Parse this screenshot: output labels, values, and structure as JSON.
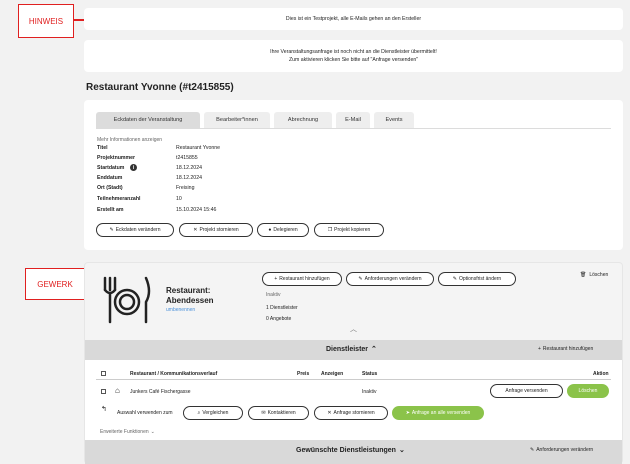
{
  "annotations": {
    "hinweis": "HINWEIS",
    "gewerk": "GEWERK",
    "color": "#e02020"
  },
  "notice1": "Dies ist ein Testprojekt, alle E-Mails gehen an den Ersteller",
  "notice2": {
    "line1": "Ihre Veranstaltungsanfrage ist noch nicht an die Dienstleister übermittelt!",
    "line2": "Zum aktivieren klicken Sie bitte auf \"Anfrage versenden\""
  },
  "page_title": "Restaurant Yvonne (#t2415855)",
  "tabs": [
    {
      "label": "Eckdaten der Veranstaltung"
    },
    {
      "label": "Bearbeiter*innen"
    },
    {
      "label": "Abrechnung"
    },
    {
      "label": "E-Mail"
    },
    {
      "label": "Events"
    }
  ],
  "more_info_link": "Mehr Informationen anzeigen",
  "details": [
    {
      "key": "Titel",
      "value": "Restaurant Yvonne"
    },
    {
      "key": "Projektnummer",
      "value": "t2415855"
    },
    {
      "key": "Startdatum",
      "value": "18.12.2024"
    },
    {
      "key": "Enddatum",
      "value": "18.12.2024"
    },
    {
      "key": "Ort (Stadt)",
      "value": "Freising"
    },
    {
      "key": "Teilnehmeranzahl",
      "value": "10"
    },
    {
      "key": "Erstellt am",
      "value": "15.10.2024 15:46"
    }
  ],
  "actions": {
    "edit": "Eckdaten verändern",
    "cancel": "Projekt stornieren",
    "delegate": "Delegieren",
    "copy": "Projekt kopieren"
  },
  "gewerk": {
    "name": "Restaurant: Abendessen",
    "sub": "umbenennen",
    "status": "Inaktiv",
    "providers_count": "1 Dienstleister",
    "offers_count": "0 Angebote",
    "btn_add": "Restaurant hinzufügen",
    "btn_requirements": "Anforderungen verändern",
    "btn_deadline": "Optionsfrist ändern",
    "delete": "Löschen"
  },
  "providers": {
    "header": "Dienstleister",
    "add": "Restaurant hinzufügen",
    "columns": [
      "Restaurant / Kommunikationsverlauf",
      "Preis",
      "Anzeigen",
      "Status",
      "Aktion"
    ],
    "rows": [
      {
        "name": "Junkers Café Fischergasse",
        "status": "Inaktiv",
        "send": "Anfrage versenden",
        "delete": "Löschen"
      }
    ],
    "selection_label": "Auswahl verwenden zum",
    "btn_compare": "Vergleichen",
    "btn_contact": "Kontaktieren",
    "btn_cancel": "Anfrage stornieren",
    "btn_send_all": "Anfrage an alle versenden",
    "advanced": "Erweiterte Funktionen"
  },
  "services": {
    "header": "Gewünschte Dienstleistungen",
    "edit": "Anforderungen verändern"
  }
}
